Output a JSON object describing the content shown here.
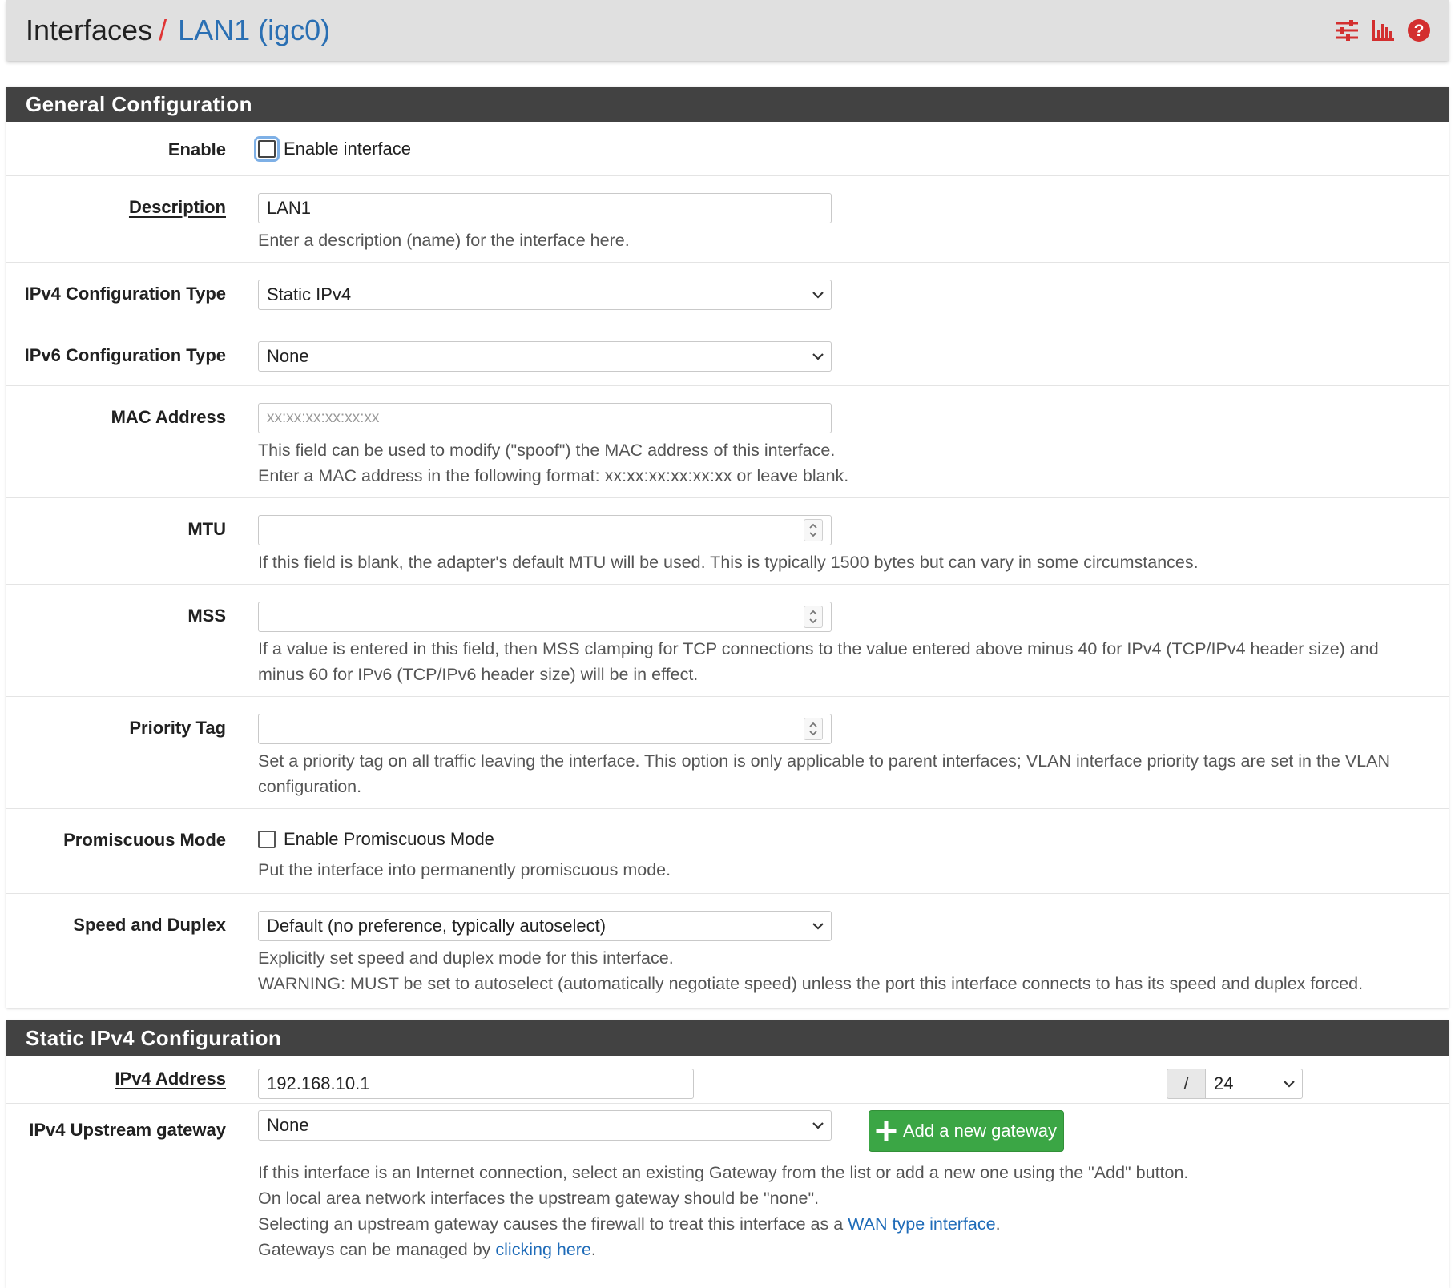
{
  "breadcrumb": {
    "root": "Interfaces",
    "separator": "/",
    "current": "LAN1 (igc0)"
  },
  "header_icons": [
    "sliders-icon",
    "bar-chart-icon",
    "help-icon"
  ],
  "colors": {
    "accent_red": "#e03434",
    "link_blue": "#1e6bb8",
    "panel_header": "#424242",
    "success_green": "#3ba645"
  },
  "general": {
    "title": "General Configuration",
    "enable": {
      "label": "Enable",
      "checkbox_label": "Enable interface",
      "checked": false
    },
    "description": {
      "label": "Description",
      "value": "LAN1",
      "help": "Enter a description (name) for the interface here."
    },
    "ipv4_type": {
      "label": "IPv4 Configuration Type",
      "value": "Static IPv4"
    },
    "ipv6_type": {
      "label": "IPv6 Configuration Type",
      "value": "None"
    },
    "mac": {
      "label": "MAC Address",
      "placeholder": "xx:xx:xx:xx:xx:xx",
      "help1": "This field can be used to modify (\"spoof\") the MAC address of this interface.",
      "help2": "Enter a MAC address in the following format: xx:xx:xx:xx:xx:xx or leave blank."
    },
    "mtu": {
      "label": "MTU",
      "value": "",
      "help": "If this field is blank, the adapter's default MTU will be used. This is typically 1500 bytes but can vary in some circumstances."
    },
    "mss": {
      "label": "MSS",
      "value": "",
      "help1": "If a value is entered in this field, then MSS clamping for TCP connections to the value entered above minus 40 for IPv4 (TCP/IPv4 header size) and",
      "help2": "minus 60 for IPv6 (TCP/IPv6 header size) will be in effect."
    },
    "priority": {
      "label": "Priority Tag",
      "value": "",
      "help1": "Set a priority tag on all traffic leaving the interface. This option is only applicable to parent interfaces; VLAN interface priority tags are set in the VLAN",
      "help2": "configuration."
    },
    "promisc": {
      "label": "Promiscuous Mode",
      "checkbox_label": "Enable Promiscuous Mode",
      "checked": false,
      "help": "Put the interface into permanently promiscuous mode."
    },
    "speed": {
      "label": "Speed and Duplex",
      "value": "Default (no preference, typically autoselect)",
      "help1": "Explicitly set speed and duplex mode for this interface.",
      "help2": "WARNING: MUST be set to autoselect (automatically negotiate speed) unless the port this interface connects to has its speed and duplex forced."
    }
  },
  "static4": {
    "title": "Static IPv4 Configuration",
    "address": {
      "label": "IPv4 Address",
      "value": "192.168.10.1",
      "slash": "/",
      "cidr": "24"
    },
    "gateway": {
      "label": "IPv4 Upstream gateway",
      "value": "None",
      "add_button": "Add a new gateway",
      "help1": "If this interface is an Internet connection, select an existing Gateway from the list or add a new one using the \"Add\" button.",
      "help2": "On local area network interfaces the upstream gateway should be \"none\".",
      "help3_pre": "Selecting an upstream gateway causes the firewall to treat this interface as a ",
      "help3_link": "WAN type interface",
      "help3_post": ".",
      "help4_pre": "Gateways can be managed by ",
      "help4_link": "clicking here",
      "help4_post": "."
    }
  }
}
